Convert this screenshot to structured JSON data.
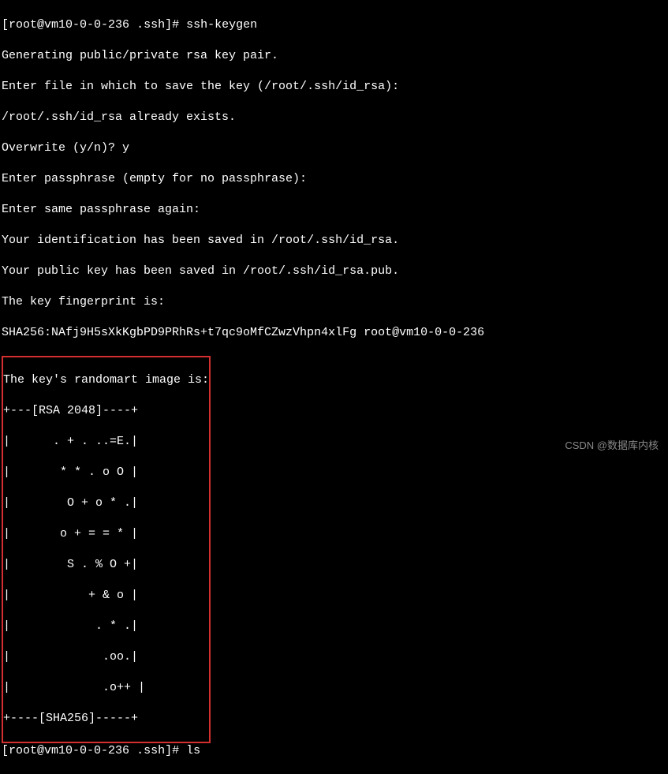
{
  "prompt1": {
    "user_host": "root@vm10-0-0-236",
    "dir": ".ssh",
    "cmd": "ssh-keygen"
  },
  "output": {
    "line1": "Generating public/private rsa key pair.",
    "line2": "Enter file in which to save the key (/root/.ssh/id_rsa):",
    "line3": "/root/.ssh/id_rsa already exists.",
    "line4_prompt": "Overwrite (y/n)? ",
    "line4_input": "y",
    "line5": "Enter passphrase (empty for no passphrase):",
    "line6": "Enter same passphrase again:",
    "line7": "Your identification has been saved in /root/.ssh/id_rsa.",
    "line8": "Your public key has been saved in /root/.ssh/id_rsa.pub.",
    "line9": "The key fingerprint is:",
    "line10": "SHA256:NAfj9H5sXkKgbPD9PRhRs+t7qc9oMfCZwzVhpn4xlFg root@vm10-0-0-236"
  },
  "randomart": {
    "header": "The key's randomart image is:",
    "lines": [
      "+---[RSA 2048]----+",
      "|      . + . ..=E.|",
      "|       * * . o O |",
      "|        O + o * .|",
      "|       o + = = * |",
      "|        S . % O +|",
      "|           + & o |",
      "|            . * .|",
      "|             .oo.|",
      "|             .o++ |",
      "+----[SHA256]-----+"
    ]
  },
  "prompt2": {
    "user_host": "root@vm10-0-0-236",
    "dir": ".ssh",
    "cmd": "ls"
  },
  "watermark": "CSDN @数据库内核"
}
